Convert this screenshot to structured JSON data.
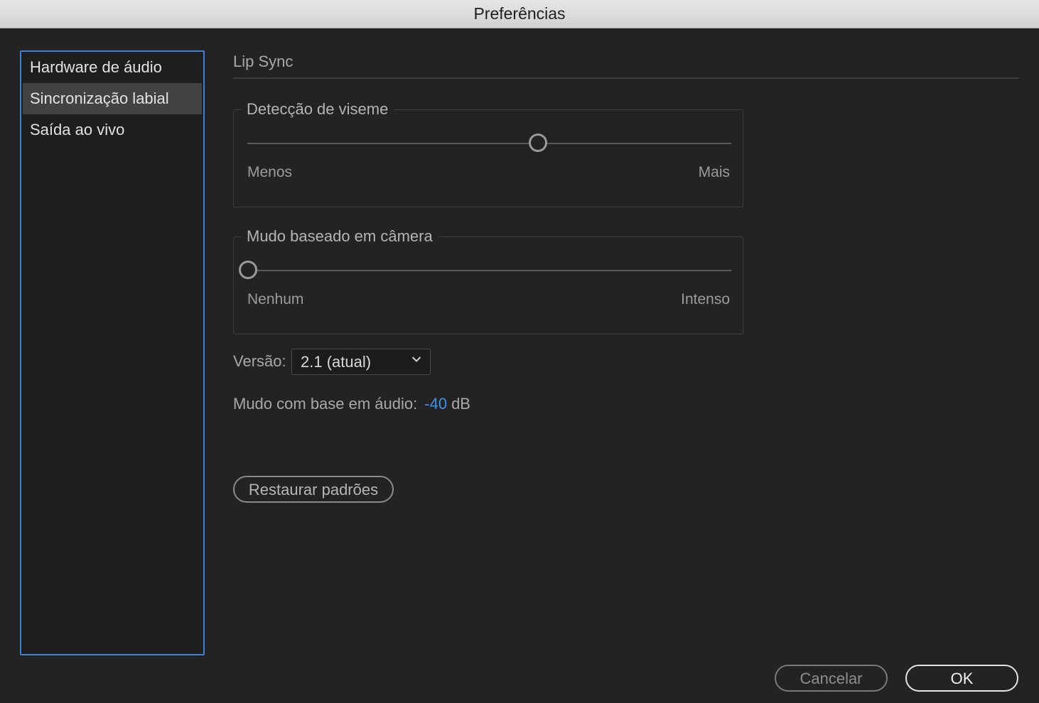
{
  "window": {
    "title": "Preferências"
  },
  "sidebar": {
    "items": [
      {
        "label": "Hardware de áudio",
        "selected": false
      },
      {
        "label": "Sincronização labial",
        "selected": true
      },
      {
        "label": "Saída ao vivo",
        "selected": false
      }
    ]
  },
  "main": {
    "section_title": "Lip Sync",
    "viseme": {
      "label": "Detecção de viseme",
      "min_label": "Menos",
      "max_label": "Mais",
      "value_fraction": 0.6
    },
    "camera_mute": {
      "label": "Mudo baseado em câmera",
      "min_label": "Nenhum",
      "max_label": "Intenso",
      "value_fraction": 0.0
    },
    "version": {
      "label": "Versão:",
      "selected": "2.1 (atual)"
    },
    "audio_mute": {
      "label": "Mudo com base em áudio:",
      "value": "-40",
      "unit": "dB"
    },
    "restore_button": "Restaurar padrões"
  },
  "footer": {
    "cancel_label": "Cancelar",
    "ok_label": "OK"
  },
  "colors": {
    "accent": "#3f7fd4",
    "value_blue": "#3f8fe8",
    "background": "#232323"
  }
}
